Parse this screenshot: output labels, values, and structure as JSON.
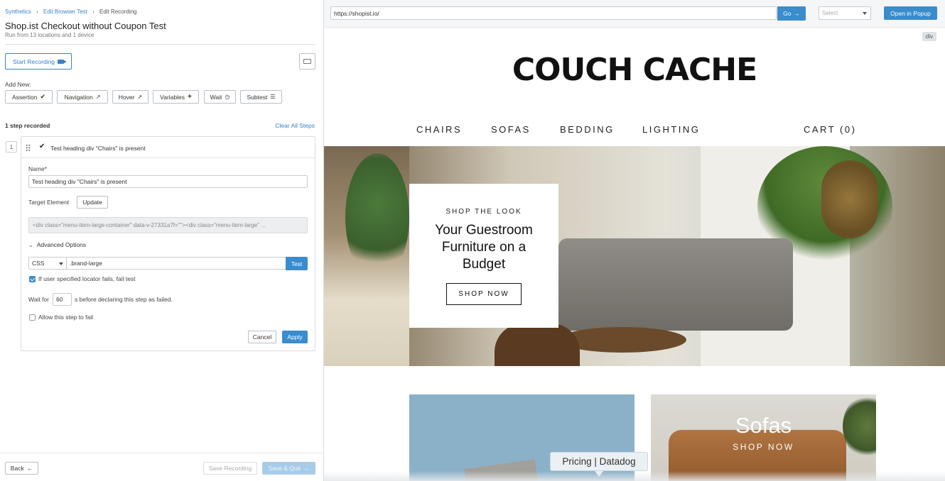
{
  "breadcrumb": {
    "items": [
      "Synthetics",
      "Edit Browser Test",
      "Edit Recording"
    ]
  },
  "header": {
    "title": "Shop.ist Checkout without Coupon Test",
    "subtitle": "Run from 13 locations and 1 device"
  },
  "recording": {
    "start_label": "Start Recording",
    "keyboard_icon": "keyboard-icon"
  },
  "add_new": {
    "label": "Add New:",
    "buttons": [
      {
        "label": "Assertion",
        "icon": "checkmark-icon"
      },
      {
        "label": "Navigation",
        "icon": "external-link-icon"
      },
      {
        "label": "Hover",
        "icon": "cursor-icon"
      },
      {
        "label": "Variables",
        "icon": "plus-icon"
      },
      {
        "label": "Wait",
        "icon": "clock-icon"
      },
      {
        "label": "Subtest",
        "icon": "list-icon"
      }
    ]
  },
  "steps": {
    "count_label": "1 step recorded",
    "clear_label": "Clear All Steps",
    "items": [
      {
        "number": "1",
        "title": "Test heading div \"Chairs\" is present",
        "name_label": "Name*",
        "name_value": "Test heading div \"Chairs\" is present",
        "target_label": "Target Element",
        "update_label": "Update",
        "target_html": "<div class=\"menu-item-large-container\" data-v-27331a7f=\"\"><div class=\"menu-item-large\" ...",
        "advanced_label": "Advanced Options",
        "locator_type": "CSS",
        "locator_value": ".brand-large",
        "test_label": "Test",
        "fail_locator_label": "If user specified locator fails, fail test",
        "fail_locator_checked": true,
        "wait_prefix": "Wait for",
        "wait_value": "60",
        "wait_suffix": "s before declaring this step as failed.",
        "allow_fail_label": "Allow this step to fail",
        "allow_fail_checked": false,
        "cancel_label": "Cancel",
        "apply_label": "Apply"
      }
    ]
  },
  "footer": {
    "back_label": "Back",
    "save_recording_label": "Save Recording",
    "save_quit_label": "Save & Quit"
  },
  "browser": {
    "url": "https://shopist.io/",
    "go_label": "Go",
    "select_placeholder": "Select",
    "popup_label": "Open in Popup",
    "element_badge": "div"
  },
  "site": {
    "brand": "COUCH CACHE",
    "nav": [
      "CHAIRS",
      "SOFAS",
      "BEDDING",
      "LIGHTING",
      "CART (0)"
    ],
    "hero": {
      "kicker": "SHOP THE LOOK",
      "headline": "Your Guestroom Furniture on a Budget",
      "cta": "SHOP NOW"
    },
    "tiles": [
      {
        "title": "",
        "cta": ""
      },
      {
        "title": "Sofas",
        "cta": "SHOP NOW"
      }
    ]
  },
  "tooltip": "Pricing | Datadog",
  "colors": {
    "accent": "#3a8ccc",
    "link": "#3a82c4"
  }
}
